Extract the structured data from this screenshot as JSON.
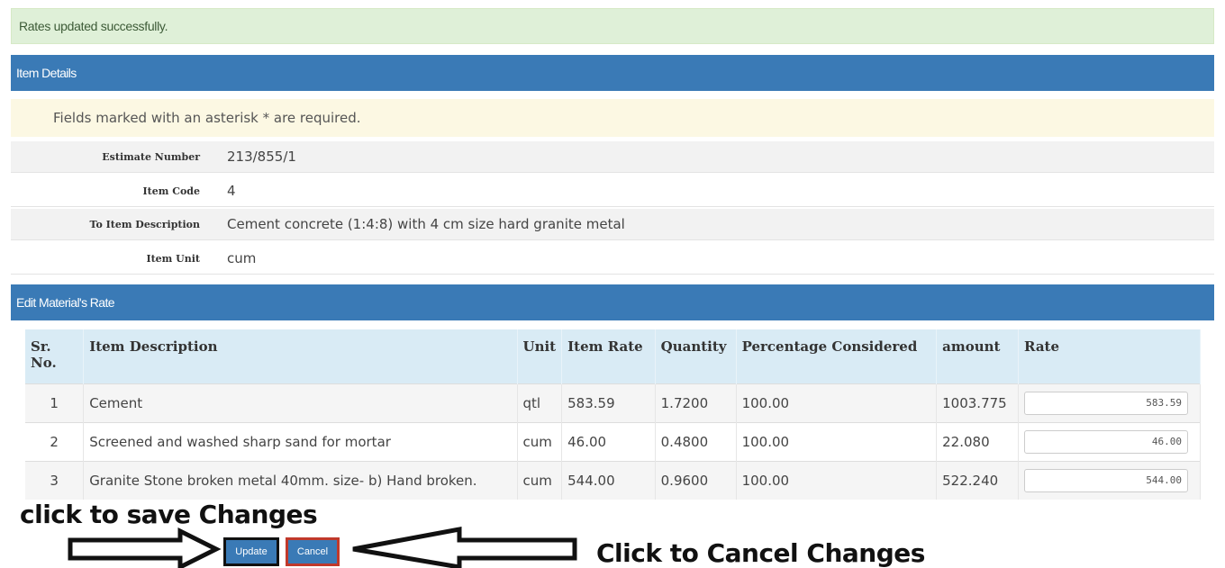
{
  "alert": {
    "message": "Rates updated successfully."
  },
  "item_details": {
    "title": "Item Details",
    "required_note": "Fields marked with an asterisk * are required.",
    "fields": [
      {
        "label": "Estimate Number",
        "value": "213/855/1"
      },
      {
        "label": "Item Code",
        "value": "4"
      },
      {
        "label": "To Item Description",
        "value": "Cement concrete (1:4:8) with 4 cm size hard granite metal"
      },
      {
        "label": "Item Unit",
        "value": "cum"
      }
    ]
  },
  "materials": {
    "title": "Edit Material's Rate",
    "columns": [
      "Sr. No.",
      "Item Description",
      "Unit",
      "Item Rate",
      "Quantity",
      "Percentage Considered",
      "amount",
      "Rate"
    ],
    "rows": [
      {
        "sr": "1",
        "description": "Cement",
        "unit": "qtl",
        "item_rate": "583.59",
        "quantity": "1.7200",
        "percentage": "100.00",
        "amount": "1003.775",
        "rate": "583.59"
      },
      {
        "sr": "2",
        "description": "Screened and washed sharp sand for mortar",
        "unit": "cum",
        "item_rate": "46.00",
        "quantity": "0.4800",
        "percentage": "100.00",
        "amount": "22.080",
        "rate": "46.00"
      },
      {
        "sr": "3",
        "description": "Granite Stone broken metal 40mm. size- b) Hand broken.",
        "unit": "cum",
        "item_rate": "544.00",
        "quantity": "0.9600",
        "percentage": "100.00",
        "amount": "522.240",
        "rate": "544.00"
      }
    ]
  },
  "actions": {
    "update_label": "Update",
    "cancel_label": "Cancel"
  },
  "annotations": {
    "save_caption": "click to save Changes",
    "cancel_caption": "Click to Cancel Changes"
  },
  "colors": {
    "panel_header": "#3a7ab6",
    "alert_bg": "#dff0d8",
    "note_bg": "#fcf8e3",
    "table_header_bg": "#d9ebf5"
  }
}
